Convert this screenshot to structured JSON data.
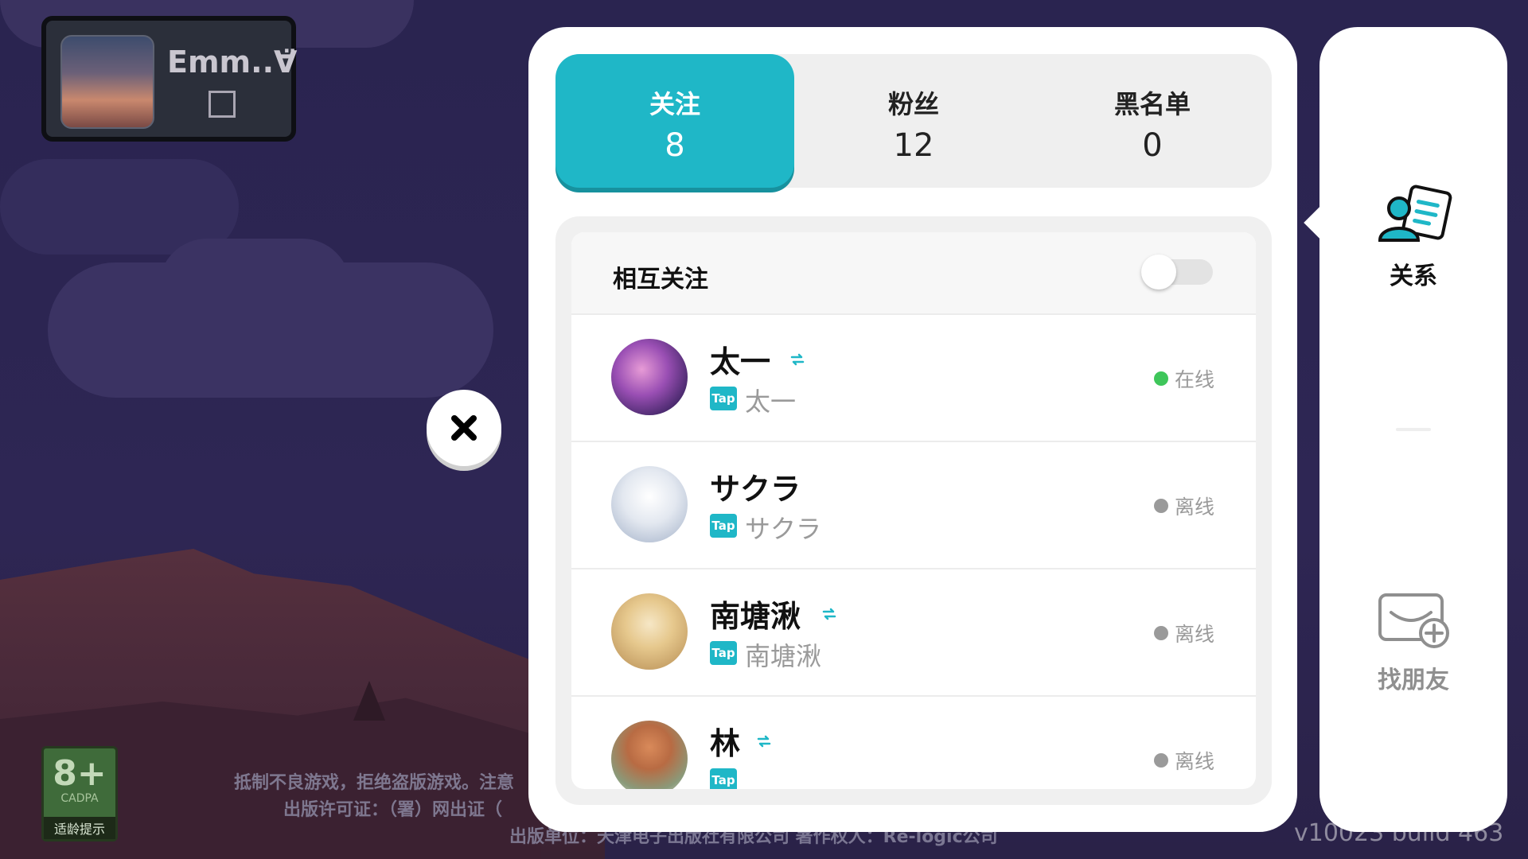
{
  "profile": {
    "name": "Emm..∀̈"
  },
  "age_rating": {
    "big": "8+",
    "org": "CADPA",
    "tag": "适龄提示"
  },
  "notice": {
    "line1": "抵制不良游戏，拒绝盗版游戏。注意",
    "line2": "出版许可证：（署）网出证（",
    "line3": "出版单位：天津电子出版社有限公司 著作权人：Re-logic公司"
  },
  "version": "v10023   build 463",
  "tabs": [
    {
      "label": "关注",
      "count": "8",
      "active": true
    },
    {
      "label": "粉丝",
      "count": "12",
      "active": false
    },
    {
      "label": "黑名单",
      "count": "0",
      "active": false
    }
  ],
  "mutual_filter": {
    "label": "相互关注",
    "enabled": false
  },
  "friends": [
    {
      "name": "太一",
      "sub": "太一",
      "status": "在线",
      "online": true,
      "mutual": true
    },
    {
      "name": "サクラ",
      "sub": "サクラ",
      "status": "离线",
      "online": false,
      "mutual": false
    },
    {
      "name": "南塘湫",
      "sub": "南塘湫",
      "status": "离线",
      "online": false,
      "mutual": true
    },
    {
      "name": "林",
      "sub": "",
      "status": "离线",
      "online": false,
      "mutual": true
    }
  ],
  "tap_badge": "Tap",
  "side": {
    "relations_label": "关系",
    "find_friends_label": "找朋友"
  },
  "colors": {
    "accent": "#1fb7c7",
    "online": "#3ec65a"
  }
}
